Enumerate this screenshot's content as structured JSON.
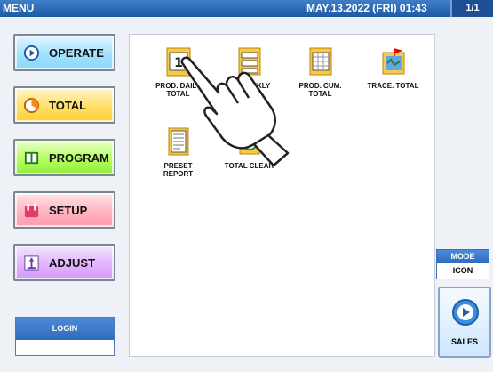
{
  "header": {
    "title": "MENU",
    "datetime": "MAY.13.2022 (FRI)  01:43",
    "page": "1/1"
  },
  "sidebar": {
    "items": [
      {
        "label": "OPERATE",
        "icon": "play-icon"
      },
      {
        "label": "TOTAL",
        "icon": "pie-icon"
      },
      {
        "label": "PROGRAM",
        "icon": "book-icon"
      },
      {
        "label": "SETUP",
        "icon": "tool-icon"
      },
      {
        "label": "ADJUST",
        "icon": "scale-icon"
      }
    ]
  },
  "login": {
    "label": "LOGIN",
    "user": ""
  },
  "main": {
    "tiles": [
      {
        "label_line1": "PROD. DAILY",
        "label_line2": "TOTAL",
        "icon": "calendar-icon"
      },
      {
        "label_line1": "WEEKLY",
        "label_line2": "",
        "icon": "weekly-report-icon"
      },
      {
        "label_line1": "PROD. CUM.",
        "label_line2": "TOTAL",
        "icon": "cumulative-report-icon"
      },
      {
        "label_line1": "TRACE. TOTAL",
        "label_line2": "",
        "icon": "trace-map-icon"
      },
      {
        "label_line1": "PRESET",
        "label_line2": "REPORT",
        "icon": "document-icon"
      },
      {
        "label_line1": "TOTAL CLEAR",
        "label_line2": "",
        "icon": "clear-icon"
      }
    ]
  },
  "mode": {
    "label": "MODE",
    "value": "ICON"
  },
  "sales": {
    "label": "SALES",
    "icon": "play-circle-icon"
  }
}
